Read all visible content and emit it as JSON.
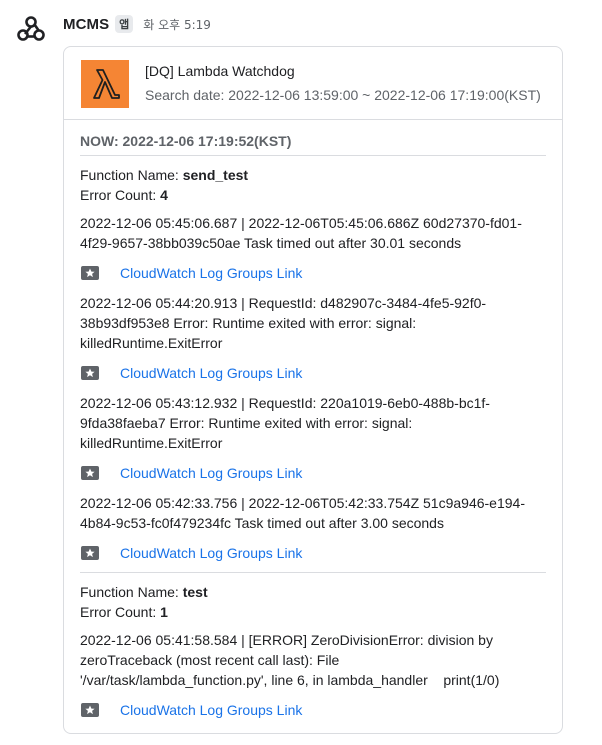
{
  "message": {
    "sender": "MCMS",
    "badge": "앱",
    "time": "화 오후 5:19"
  },
  "card": {
    "title": "[DQ] Lambda Watchdog",
    "subtitle": "Search date: 2022-12-06 13:59:00 ~ 2022-12-06 17:19:00(KST)",
    "now": "NOW: 2022-12-06 17:19:52(KST)",
    "link_label": "CloudWatch Log Groups Link",
    "functions": [
      {
        "name_label": "Function Name: ",
        "name": "send_test",
        "count_label": "Error Count: ",
        "count": "4",
        "errors": [
          {
            "line1": "2022-12-06 05:45:06.687 | 2022-12-06T05:45:06.686Z 60d27370-fd01-",
            "line2": "4f29-9657-38bb039c50ae Task timed out after 30.01 seconds"
          },
          {
            "line1": "2022-12-06 05:44:20.913 | RequestId: d482907c-3484-4fe5-92f0-",
            "line2": "38b93df953e8 Error: Runtime exited with error: signal:",
            "line3": "killedRuntime.ExitError"
          },
          {
            "line1": "2022-12-06 05:43:12.932 | RequestId: 220a1019-6eb0-488b-bc1f-",
            "line2": "9fda38faeba7 Error: Runtime exited with error: signal:",
            "line3": "killedRuntime.ExitError"
          },
          {
            "line1": "2022-12-06 05:42:33.756 | 2022-12-06T05:42:33.754Z 51c9a946-e194-",
            "line2": "4b84-9c53-fc0f479234fc Task timed out after 3.00 seconds"
          }
        ]
      },
      {
        "name_label": "Function Name: ",
        "name": "test",
        "count_label": "Error Count: ",
        "count": "1",
        "errors": [
          {
            "line1": "2022-12-06 05:41:58.584 | [ERROR] ZeroDivisionError: division by",
            "line2": "zeroTraceback (most recent call last):  File",
            "line3": "'/var/task/lambda_function.py', line 6, in lambda_handler    print(1/0)"
          }
        ]
      }
    ]
  },
  "colors": {
    "lambda_orange": "#f58534",
    "link_blue": "#1a73e8",
    "divider": "#dadce0"
  },
  "icons": {
    "avatar": "webhook-icon",
    "logo": "aws-lambda-icon",
    "link": "cloudwatch-star-icon"
  }
}
